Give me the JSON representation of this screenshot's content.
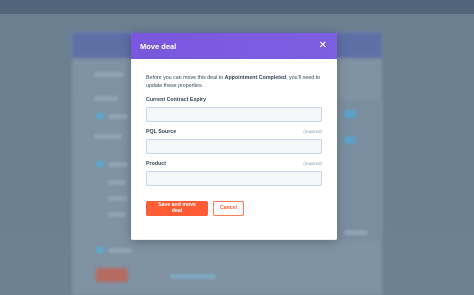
{
  "modal": {
    "title": "Move deal",
    "intro_before": "Before you can move this deal to ",
    "intro_stage": "Appointment Completed",
    "intro_after": ", you'll need to update these properties.",
    "fields": [
      {
        "label": "Current Contract Expiry",
        "required_text": "",
        "value": ""
      },
      {
        "label": "PQL Source",
        "required_text": "(required)",
        "value": ""
      },
      {
        "label": "Product",
        "required_text": "(required)",
        "value": ""
      }
    ],
    "save_label": "Save and move deal",
    "cancel_label": "Cancel",
    "close_glyph": "✕"
  },
  "colors": {
    "header": "#7c5ce0",
    "primary_button": "#ff5c35",
    "overlay": "#6a7f90"
  },
  "icons": {
    "close": "close-icon"
  }
}
